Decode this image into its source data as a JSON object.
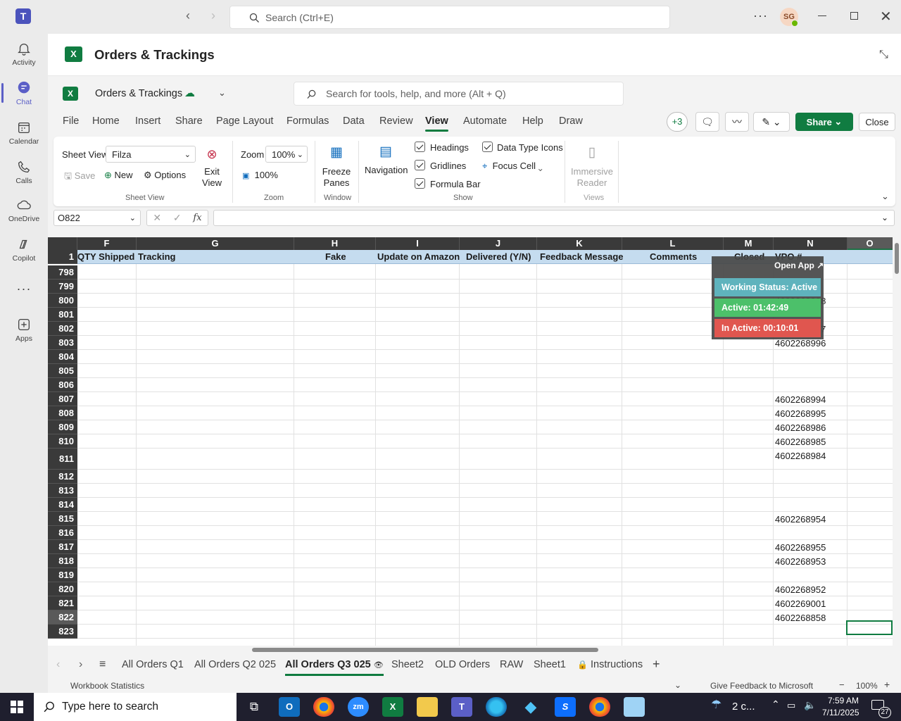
{
  "teams": {
    "search_placeholder": "Search (Ctrl+E)",
    "avatar_initials": "SG",
    "rail": [
      {
        "label": "Activity",
        "icon": "bell-icon"
      },
      {
        "label": "Chat",
        "icon": "chat-icon"
      },
      {
        "label": "Calendar",
        "icon": "calendar-icon"
      },
      {
        "label": "Calls",
        "icon": "phone-icon"
      },
      {
        "label": "OneDrive",
        "icon": "cloud-icon"
      },
      {
        "label": "Copilot",
        "icon": "copilot-icon"
      },
      {
        "label": "...",
        "icon": "more-icon"
      },
      {
        "label": "Apps",
        "icon": "add-app-icon"
      }
    ]
  },
  "app": {
    "title": "Orders & Trackings"
  },
  "excel": {
    "doc_name": "Orders & Trackings",
    "search_placeholder": "Search for tools, help, and more (Alt + Q)",
    "menus": [
      "File",
      "Home",
      "Insert",
      "Share",
      "Page Layout",
      "Formulas",
      "Data",
      "Review",
      "View",
      "Automate",
      "Help",
      "Draw"
    ],
    "selected_menu": "View",
    "collaborators_badge": "+3",
    "share_label": "Share",
    "close_label": "Close",
    "ribbon": {
      "sheet_view_label": "Sheet View",
      "sheet_view_value": "Filza",
      "save": "Save",
      "new": "New",
      "options": "Options",
      "exit_view": "Exit View",
      "group_sheet_view": "Sheet View",
      "zoom_label": "Zoom",
      "zoom_value": "100%",
      "zoom_100": "100%",
      "group_zoom": "Zoom",
      "freeze_panes": "Freeze Panes",
      "group_window": "Window",
      "navigation": "Navigation",
      "headings": "Headings",
      "gridlines": "Gridlines",
      "formula_bar": "Formula Bar",
      "data_type_icons": "Data Type Icons",
      "focus_cell": "Focus Cell",
      "group_show": "Show",
      "immersive_reader": "Immersive Reader",
      "group_views": "Views"
    },
    "name_box": "O822",
    "fx": "fx"
  },
  "grid": {
    "columns": [
      "F",
      "G",
      "H",
      "I",
      "J",
      "K",
      "L",
      "M",
      "N",
      "O"
    ],
    "selected_column": "O",
    "header_row_number": "1",
    "header_cells": [
      "QTY Shipped",
      "Tracking",
      "Fake",
      "Update on Amazon",
      "Delivered (Y/N)",
      "Feedback Message",
      "Comments",
      "Closed",
      "VPO #"
    ],
    "rows": [
      {
        "n": "798",
        "vpo": ""
      },
      {
        "n": "799",
        "vpo": ""
      },
      {
        "n": "800",
        "vpo": "4602268998"
      },
      {
        "n": "801",
        "vpo": ""
      },
      {
        "n": "802",
        "vpo": "4602268997"
      },
      {
        "n": "803",
        "vpo": "4602268996"
      },
      {
        "n": "804",
        "vpo": ""
      },
      {
        "n": "805",
        "vpo": ""
      },
      {
        "n": "806",
        "vpo": ""
      },
      {
        "n": "807",
        "vpo": "4602268994"
      },
      {
        "n": "808",
        "vpo": "4602268995"
      },
      {
        "n": "809",
        "vpo": "4602268986"
      },
      {
        "n": "810",
        "vpo": "4602268985"
      },
      {
        "n": "811",
        "vpo": "4602268984"
      },
      {
        "n": "812",
        "vpo": ""
      },
      {
        "n": "813",
        "vpo": ""
      },
      {
        "n": "814",
        "vpo": ""
      },
      {
        "n": "815",
        "vpo": "4602268954"
      },
      {
        "n": "816",
        "vpo": ""
      },
      {
        "n": "817",
        "vpo": "4602268955"
      },
      {
        "n": "818",
        "vpo": "4602268953"
      },
      {
        "n": "819",
        "vpo": ""
      },
      {
        "n": "820",
        "vpo": "4602268952"
      },
      {
        "n": "821",
        "vpo": "4602269001"
      },
      {
        "n": "822",
        "vpo": "4602268858"
      },
      {
        "n": "823",
        "vpo": ""
      }
    ],
    "selected_row": "822"
  },
  "widget": {
    "open_app": "Open App ↗",
    "working_status": "Working Status: Active",
    "active": "Active: 01:42:49",
    "inactive": "In Active: 00:10:01",
    "colors": {
      "status": "#5fb3bd",
      "active": "#4cc06a",
      "inactive": "#e0564f"
    }
  },
  "sheets": {
    "tabs": [
      "All Orders Q1",
      "All Orders Q2 025",
      "All Orders Q3 025",
      "Sheet2",
      "OLD Orders",
      "RAW",
      "Sheet1",
      "Instructions"
    ],
    "selected": "All Orders Q3 025"
  },
  "status": {
    "workbook_statistics": "Workbook Statistics",
    "feedback": "Give Feedback to Microsoft",
    "zoom": "100%"
  },
  "taskbar": {
    "search_placeholder": "Type here to search",
    "weather": "2 c...",
    "time": "7:59 AM",
    "date": "7/11/2025",
    "notification_count": "27"
  }
}
